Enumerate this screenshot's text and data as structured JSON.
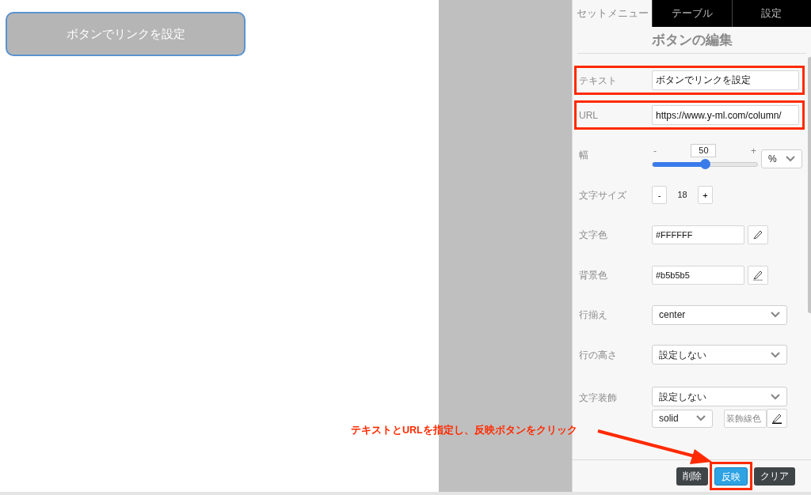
{
  "preview": {
    "button_label": "ボタンでリンクを設定"
  },
  "tabs": [
    {
      "label": "セットメニュー",
      "selected": true
    },
    {
      "label": "テーブル",
      "selected": false
    },
    {
      "label": "設定",
      "selected": false
    }
  ],
  "panel": {
    "title": "ボタンの編集"
  },
  "fields": [
    {
      "kind": "text",
      "label": "テキスト",
      "value": "ボタンでリンクを設定",
      "highlighted": true
    },
    {
      "kind": "text",
      "label": "URL",
      "value": "https://www.y-ml.com/column/",
      "highlighted": true
    },
    {
      "kind": "slider",
      "label": "幅",
      "minus": "-",
      "plus": "+",
      "reading": "50",
      "level": 0.5,
      "unit": "%",
      "highlighted": false
    },
    {
      "kind": "stepper",
      "label": "文字サイズ",
      "minus": "-",
      "value": "18",
      "plus": "+",
      "highlighted": false
    },
    {
      "kind": "color",
      "label": "文字色",
      "value": "#FFFFFF",
      "highlighted": false
    },
    {
      "kind": "color",
      "label": "背景色",
      "value": "#b5b5b5",
      "highlighted": false
    },
    {
      "kind": "select",
      "label": "行揃え",
      "value": "center",
      "highlighted": false
    },
    {
      "kind": "select",
      "label": "行の高さ",
      "value": "設定しない",
      "highlighted": false
    },
    {
      "kind": "decoration",
      "label": "文字装飾",
      "value": "設定しない",
      "style": "solid",
      "color_placeholder": "装飾線色",
      "highlighted": false
    }
  ],
  "buttons": [
    {
      "label": "削除",
      "primary": false,
      "highlighted": false
    },
    {
      "label": "反映",
      "primary": true,
      "highlighted": true
    },
    {
      "label": "クリア",
      "primary": false,
      "highlighted": false
    }
  ],
  "annotation": {
    "text": "テキストとURLを指定し、反映ボタンをクリック"
  }
}
